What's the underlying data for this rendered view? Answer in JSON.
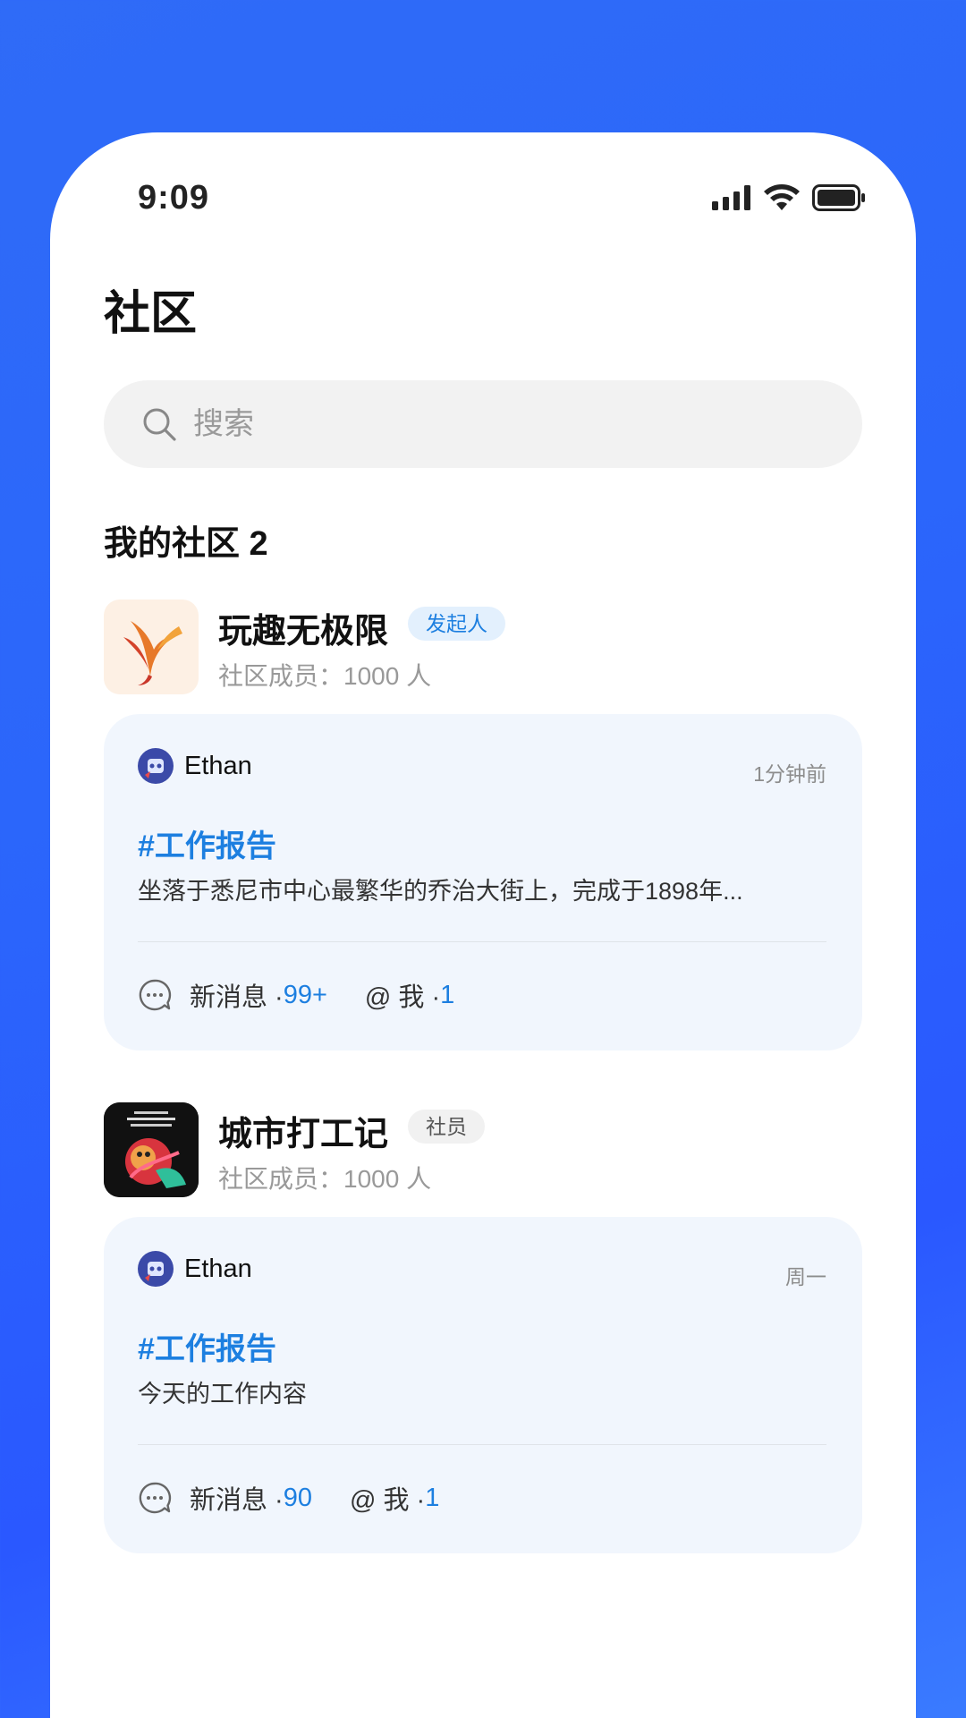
{
  "status_bar": {
    "time": "9:09"
  },
  "page": {
    "title": "社区"
  },
  "search": {
    "placeholder": "搜索"
  },
  "section": {
    "title": "我的社区 2"
  },
  "colors": {
    "accent": "#1d7fe0",
    "background_blue": "#2b66fb",
    "card_bg": "#f1f6fd"
  },
  "communities": [
    {
      "name": "玩趣无极限",
      "badge": "发起人",
      "members": "社区成员：1000 人",
      "post": {
        "author": "Ethan",
        "time": "1分钟前",
        "topic": "#工作报告",
        "text": "坐落于悉尼市中心最繁华的乔治大街上，完成于1898年...",
        "new_msg_label": "新消息 · ",
        "new_msg_count": "99+",
        "mention_label": "@ 我 ·",
        "mention_count": "1"
      }
    },
    {
      "name": "城市打工记",
      "badge": "社员",
      "members": "社区成员：1000 人",
      "post": {
        "author": "Ethan",
        "time": "周一",
        "topic": "#工作报告",
        "text": "今天的工作内容",
        "new_msg_label": "新消息 · ",
        "new_msg_count": "90",
        "mention_label": "@ 我 ·",
        "mention_count": "1"
      }
    }
  ],
  "icons": [
    "signal-icon",
    "wifi-icon",
    "battery-icon",
    "search-icon",
    "chat-bubble-icon"
  ]
}
